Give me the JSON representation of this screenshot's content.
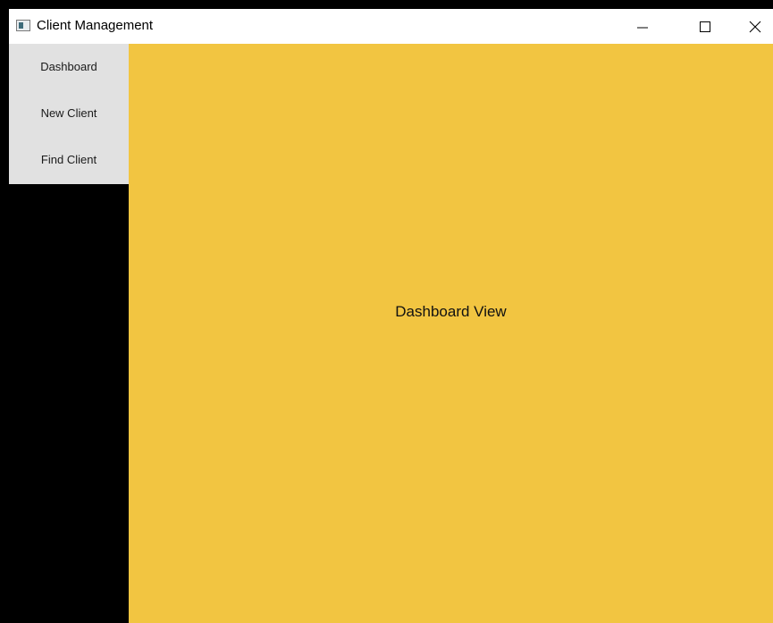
{
  "window": {
    "title": "Client Management",
    "app_icon": "window-app-icon",
    "controls": {
      "minimize_icon": "minimize-icon",
      "maximize_icon": "maximize-icon",
      "close_icon": "close-icon"
    }
  },
  "sidebar": {
    "items": [
      {
        "label": "Dashboard"
      },
      {
        "label": "New Client"
      },
      {
        "label": "Find Client"
      }
    ]
  },
  "main": {
    "label": "Dashboard View"
  },
  "colors": {
    "main_background": "#f2c541",
    "sidebar_nav_background": "#e1e1e1",
    "sidebar_background": "#000000",
    "titlebar_background": "#ffffff"
  }
}
